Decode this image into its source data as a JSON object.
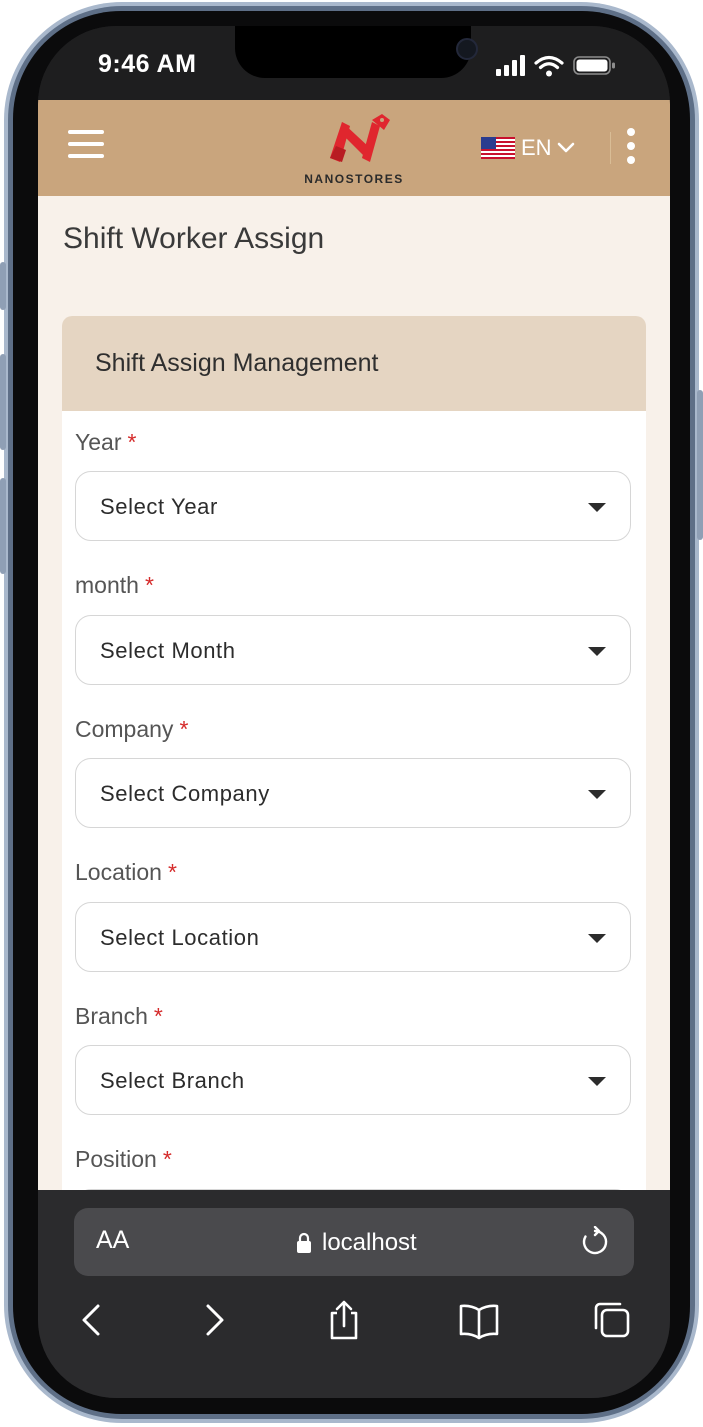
{
  "status_bar": {
    "time": "9:46 AM"
  },
  "header": {
    "logo_text": "NANOSTORES",
    "language": "EN",
    "brand_color": "#c9a57d",
    "logo_color": "#e0262e"
  },
  "page": {
    "title": "Shift Worker Assign"
  },
  "card": {
    "title": "Shift Assign Management"
  },
  "form": {
    "required_mark": "*",
    "fields": [
      {
        "label": "Year",
        "placeholder": "Select Year"
      },
      {
        "label": "month",
        "placeholder": "Select Month"
      },
      {
        "label": "Company",
        "placeholder": "Select Company"
      },
      {
        "label": "Location",
        "placeholder": "Select Location"
      },
      {
        "label": "Branch",
        "placeholder": "Select Branch"
      },
      {
        "label": "Position",
        "placeholder": ""
      }
    ]
  },
  "browser": {
    "aa_label": "AA",
    "url": "localhost",
    "icons": [
      "back-icon",
      "forward-icon",
      "share-icon",
      "bookmarks-icon",
      "tabs-icon",
      "reload-icon",
      "lock-icon"
    ]
  }
}
